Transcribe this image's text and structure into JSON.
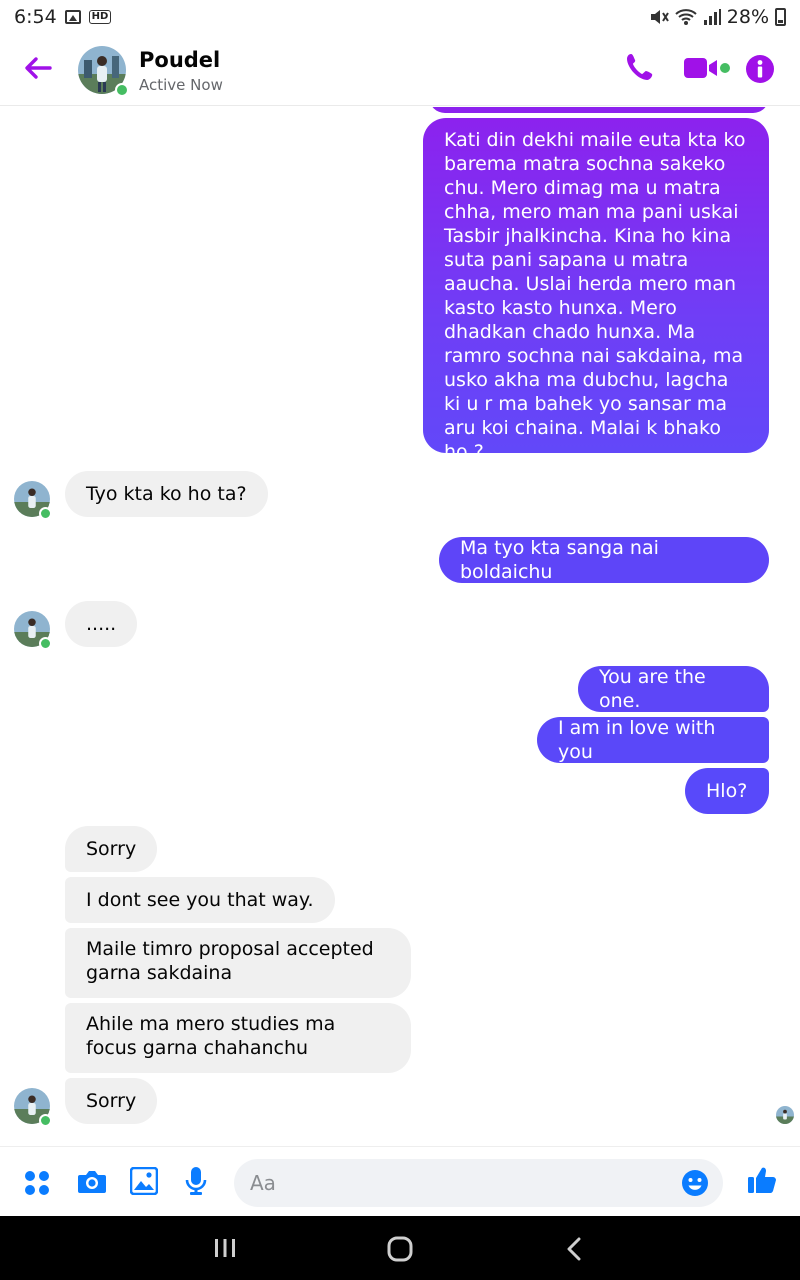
{
  "status_bar": {
    "time": "6:54",
    "hd": "HD",
    "battery": "28%"
  },
  "header": {
    "name": "Poudel",
    "status": "Active Now"
  },
  "colors": {
    "accent": "#a011e8",
    "outgoing_top": "#8a23ee",
    "outgoing_bottom": "#5b4dfa",
    "incoming": "#f0f0f0",
    "online": "#45bd62"
  },
  "messages": [
    {
      "from": "me",
      "text": "Kati din dekhi maile euta kta ko barema matra sochna sakeko chu. Mero dimag ma u matra chha, mero man ma pani uskai Tasbir jhalkincha. Kina ho kina suta pani sapana u matra aaucha. Uslai herda mero man kasto kasto hunxa. Mero dhadkan chado hunxa. Ma ramro sochna nai sakdaina, ma usko akha ma dubchu, lagcha ki u r ma bahek yo sansar ma aru koi chaina. Malai k bhako ho ?"
    },
    {
      "from": "them",
      "text": "Tyo kta ko ho ta?"
    },
    {
      "from": "me",
      "text": "Ma tyo kta sanga nai boldaichu"
    },
    {
      "from": "them",
      "text": "....."
    },
    {
      "from": "me",
      "text": "You are the one."
    },
    {
      "from": "me",
      "text": "I am in love with you"
    },
    {
      "from": "me",
      "text": "Hlo?"
    },
    {
      "from": "them",
      "text": "Sorry"
    },
    {
      "from": "them",
      "text": "I dont see you that way."
    },
    {
      "from": "them",
      "text": "Maile timro proposal accepted garna sakdaina"
    },
    {
      "from": "them",
      "text": "Ahile ma mero studies ma focus garna chahanchu"
    },
    {
      "from": "them",
      "text": "Sorry"
    }
  ],
  "composer": {
    "placeholder": "Aa"
  },
  "icons": {
    "back": "arrow-left-icon",
    "call": "phone-icon",
    "video": "video-camera-icon",
    "info": "info-icon",
    "menu": "four-dots-icon",
    "camera": "camera-icon",
    "gallery": "image-icon",
    "mic": "microphone-icon",
    "emoji": "smiley-icon",
    "like": "thumbs-up-icon"
  }
}
